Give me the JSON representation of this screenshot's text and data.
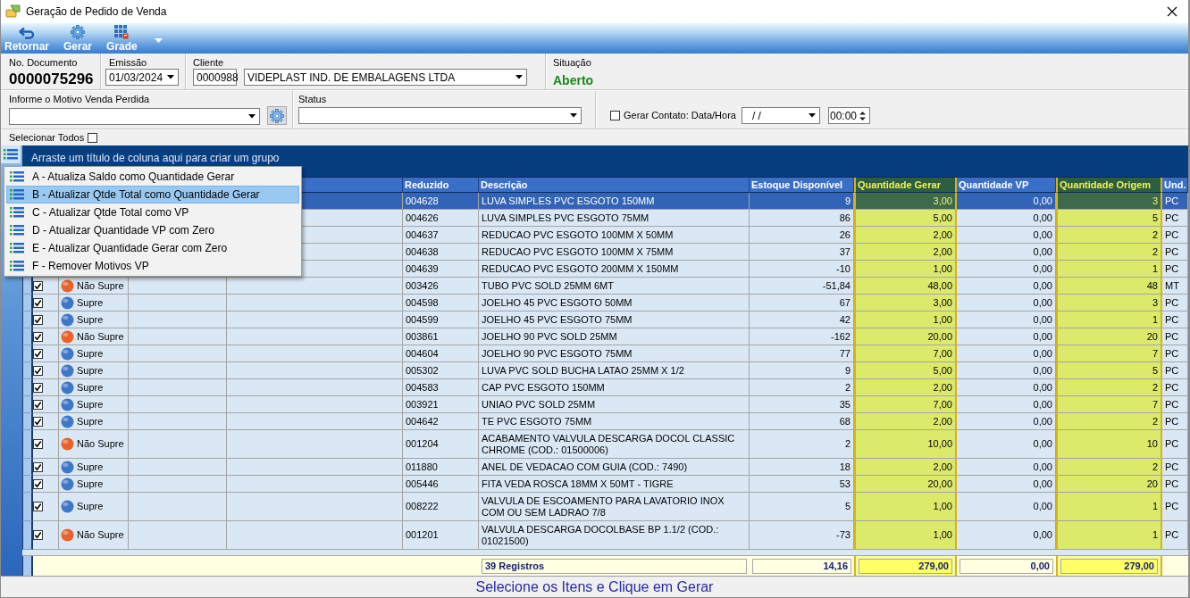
{
  "window": {
    "title": "Geração de Pedido de Venda"
  },
  "toolbar": [
    {
      "kind": "back",
      "label": "Retornar"
    },
    {
      "kind": "gear",
      "label": "Gerar"
    },
    {
      "kind": "grid",
      "label": "Grade"
    },
    {
      "kind": "dropdown"
    }
  ],
  "header": {
    "document": {
      "label": "No. Documento",
      "value": "0000075296"
    },
    "issue_date": {
      "label": "Emissão",
      "value": "01/03/2024"
    },
    "client": {
      "label": "Cliente",
      "code": "0000988",
      "name": "VIDEPLAST IND. DE EMBALAGENS LTDA"
    },
    "situation": {
      "label": "Situação",
      "value": "Aberto"
    }
  },
  "lost_sale": {
    "label": "Informe o Motivo Venda Perdida"
  },
  "status_field": {
    "label": "Status"
  },
  "contact": {
    "label": "Gerar Contato: Data/Hora",
    "checked": false,
    "date": "/ /",
    "time": "00:00"
  },
  "select_all": {
    "label": "Selecionar Todos",
    "checked": false
  },
  "grid": {
    "group_hint": "Arraste um título de coluna aqui para criar um grupo",
    "columns": [
      {
        "label": "Reduzido",
        "kind": "text",
        "highlighted": false
      },
      {
        "label": "Descrição",
        "kind": "text",
        "highlighted": false
      },
      {
        "label": "Estoque Disponível",
        "kind": "number",
        "highlighted": false
      },
      {
        "label": "Quantidade Gerar",
        "kind": "number",
        "highlighted": true
      },
      {
        "label": "Quantidade VP",
        "kind": "number",
        "highlighted": false
      },
      {
        "label": "Quantidade Origem",
        "kind": "number",
        "highlighted": true
      },
      {
        "label": "Und.",
        "kind": "text",
        "highlighted": false
      }
    ],
    "rows": [
      {
        "selected": true,
        "cells": [
          "004628",
          "LUVA SIMPLES PVC ESGOTO 150MM",
          "9",
          "3,00",
          "0,00",
          "3",
          "PC"
        ]
      },
      {
        "selected": false,
        "cells": [
          "004626",
          "LUVA SIMPLES PVC ESGOTO 75MM",
          "86",
          "5,00",
          "0,00",
          "5",
          "PC"
        ]
      },
      {
        "selected": false,
        "cells": [
          "004637",
          "REDUCAO PVC ESGOTO 100MM X 50MM",
          "26",
          "2,00",
          "0,00",
          "2",
          "PC"
        ]
      },
      {
        "selected": false,
        "cells": [
          "004638",
          "REDUCAO PVC ESGOTO 100MM X 75MM",
          "37",
          "2,00",
          "0,00",
          "2",
          "PC"
        ]
      },
      {
        "selected": false,
        "cells": [
          "004639",
          "REDUCAO PVC ESGOTO 200MM X 150MM",
          "-10",
          "1,00",
          "0,00",
          "1",
          "PC"
        ]
      },
      {
        "selected": false,
        "checked": true,
        "status": {
          "label": "Não Supre",
          "color": "#e8622a"
        },
        "cells": [
          "003426",
          "TUBO PVC SOLD 25MM 6MT",
          "-51,84",
          "48,00",
          "0,00",
          "48",
          "MT"
        ]
      },
      {
        "selected": false,
        "checked": true,
        "status": {
          "label": "Supre",
          "color": "#3f77c8"
        },
        "cells": [
          "004598",
          "JOELHO 45 PVC ESGOTO 50MM",
          "67",
          "3,00",
          "0,00",
          "3",
          "PC"
        ]
      },
      {
        "selected": false,
        "checked": true,
        "status": {
          "label": "Supre",
          "color": "#3f77c8"
        },
        "cells": [
          "004599",
          "JOELHO 45 PVC ESGOTO 75MM",
          "42",
          "1,00",
          "0,00",
          "1",
          "PC"
        ]
      },
      {
        "selected": false,
        "checked": true,
        "status": {
          "label": "Não Supre",
          "color": "#e8622a"
        },
        "cells": [
          "003861",
          "JOELHO 90 PVC SOLD 25MM",
          "-162",
          "20,00",
          "0,00",
          "20",
          "PC"
        ]
      },
      {
        "selected": false,
        "checked": true,
        "status": {
          "label": "Supre",
          "color": "#3f77c8"
        },
        "cells": [
          "004604",
          "JOELHO 90 PVC ESGOTO 75MM",
          "77",
          "7,00",
          "0,00",
          "7",
          "PC"
        ]
      },
      {
        "selected": false,
        "checked": true,
        "status": {
          "label": "Supre",
          "color": "#3f77c8"
        },
        "cells": [
          "005302",
          "LUVA PVC SOLD BUCHA LATAO 25MM X 1/2",
          "9",
          "5,00",
          "0,00",
          "5",
          "PC"
        ]
      },
      {
        "selected": false,
        "checked": true,
        "status": {
          "label": "Supre",
          "color": "#3f77c8"
        },
        "cells": [
          "004583",
          "CAP PVC ESGOTO 150MM",
          "2",
          "2,00",
          "0,00",
          "2",
          "PC"
        ]
      },
      {
        "selected": false,
        "checked": true,
        "status": {
          "label": "Supre",
          "color": "#3f77c8"
        },
        "cells": [
          "003921",
          "UNIAO PVC SOLD 25MM",
          "35",
          "7,00",
          "0,00",
          "7",
          "PC"
        ]
      },
      {
        "selected": false,
        "checked": true,
        "status": {
          "label": "Supre",
          "color": "#3f77c8"
        },
        "cells": [
          "004642",
          "TE PVC ESGOTO 75MM",
          "68",
          "2,00",
          "0,00",
          "2",
          "PC"
        ]
      },
      {
        "selected": false,
        "checked": true,
        "status": {
          "label": "Não Supre",
          "color": "#e8622a"
        },
        "cells": [
          "001204",
          "ACABAMENTO VALVULA DESCARGA DOCOL CLASSIC CHROME (COD.: 01500006)",
          "2",
          "10,00",
          "0,00",
          "10",
          "PC"
        ]
      },
      {
        "selected": false,
        "checked": true,
        "status": {
          "label": "Supre",
          "color": "#3f77c8"
        },
        "cells": [
          "011880",
          "ANEL DE VEDACAO COM GUIA (COD.: 7490)",
          "18",
          "2,00",
          "0,00",
          "2",
          "PC"
        ]
      },
      {
        "selected": false,
        "checked": true,
        "status": {
          "label": "Supre",
          "color": "#3f77c8"
        },
        "cells": [
          "005446",
          "FITA VEDA ROSCA 18MM X 50MT - TIGRE",
          "53",
          "20,00",
          "0,00",
          "20",
          "PC"
        ]
      },
      {
        "selected": false,
        "checked": true,
        "status": {
          "label": "Supre",
          "color": "#3f77c8"
        },
        "cells": [
          "008222",
          "VALVULA DE ESCOAMENTO PARA LAVATORIO INOX COM OU SEM LADRAO 7/8",
          "5",
          "1,00",
          "0,00",
          "1",
          "PC"
        ]
      },
      {
        "selected": false,
        "checked": true,
        "status": {
          "label": "Não Supre",
          "color": "#e8622a"
        },
        "cells": [
          "001201",
          "VALVULA DESCARGA DOCOLBASE BP 1.1/2 (COD.: 01021500)",
          "-73",
          "1,00",
          "0,00",
          "1",
          "PC"
        ]
      }
    ],
    "totals": {
      "count": "39 Registros",
      "stock": "14,16",
      "generate": "279,00",
      "vp": "0,00",
      "origin": "279,00"
    }
  },
  "context_menu": {
    "items": [
      {
        "label": "A - Atualiza Saldo como Quantidade Gerar",
        "selected": false
      },
      {
        "label": "B - Atualizar Qtde Total como Quantidade Gerar",
        "selected": true
      },
      {
        "label": "C - Atualizar Qtde Total como VP",
        "selected": false
      },
      {
        "label": "D - Atualizar Quantidade VP com Zero",
        "selected": false
      },
      {
        "label": "E - Atualizar Quantidade Gerar com Zero",
        "selected": false
      },
      {
        "label": "F - Remover Motivos VP",
        "selected": false
      }
    ]
  },
  "status_bar": {
    "message": "Selecione os Itens e Clique em Gerar"
  }
}
